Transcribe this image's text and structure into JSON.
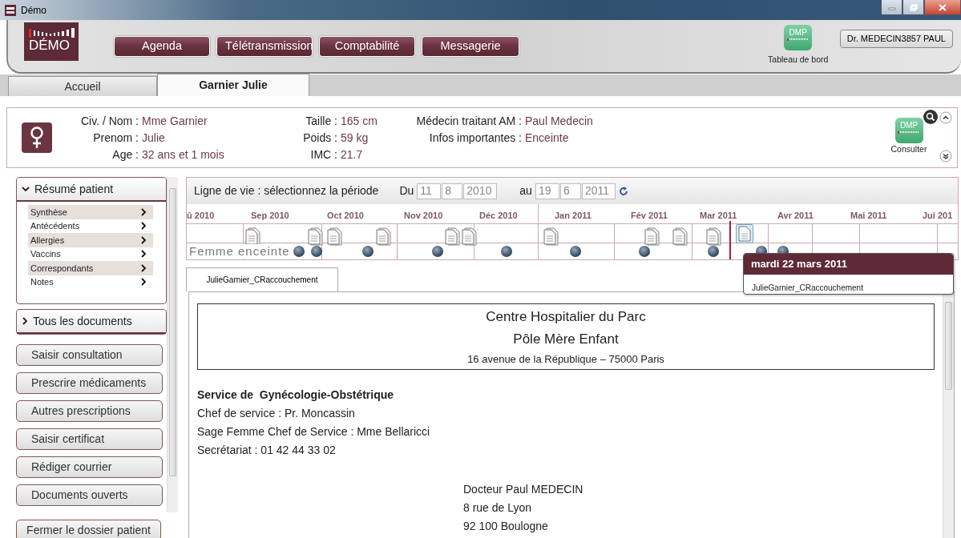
{
  "window": {
    "title": "Démo"
  },
  "logo": {
    "text": "DÉMO"
  },
  "nav_buttons": [
    "Agenda",
    "Télétransmission",
    "Comptabilité",
    "Messagerie"
  ],
  "dashboard": {
    "badge": "DMP",
    "label": "Tableau de bord"
  },
  "user": "Dr. MEDECIN3857 PAUL",
  "tabs": [
    {
      "label": "Accueil",
      "selected": false
    },
    {
      "label": "Garnier Julie",
      "selected": true
    }
  ],
  "patient": {
    "groups": [
      [
        {
          "label": "Civ. / Nom :",
          "value": "Mme Garnier"
        },
        {
          "label": "Prenom :",
          "value": "Julie"
        },
        {
          "label": "Age :",
          "value": "32 ans et 1 mois"
        }
      ],
      [
        {
          "label": "Taille :",
          "value": "165 cm"
        },
        {
          "label": "Poids :",
          "value": "59 kg"
        },
        {
          "label": "IMC :",
          "value": "21.7"
        }
      ],
      [
        {
          "label": "Médecin traitant AM :",
          "value": "Paul Medecin"
        },
        {
          "label": "Infos importantes :",
          "value": "Enceinte"
        }
      ]
    ],
    "dmp": {
      "badge": "DMP",
      "label": "Consulter"
    }
  },
  "sidebar": {
    "sections": [
      {
        "title": "Résumé patient",
        "expanded": true,
        "items": [
          "Synthèse",
          "Antécédents",
          "Allergies",
          "Vaccins",
          "Correspondants",
          "Notes"
        ]
      },
      {
        "title": "Tous les documents",
        "expanded": false
      }
    ],
    "buttons": [
      "Saisir consultation",
      "Prescrire médicaments",
      "Autres prescriptions",
      "Saisir certificat",
      "Rédiger courrier",
      "Documents ouverts"
    ],
    "close_button": "Fermer le dossier patient"
  },
  "timeline": {
    "title": "Ligne de vie : sélectionnez la période",
    "from_label": "Du",
    "from": [
      "11",
      "8",
      "2010"
    ],
    "to_label": "au",
    "to": [
      "19",
      "6",
      "2011"
    ],
    "months": [
      "û 2010",
      "Sep 2010",
      "Oct 2010",
      "Nov 2010",
      "Déc 2010",
      "Jan 2011",
      "Fév 2011",
      "Mar 2011",
      "Avr 2011",
      "Mai 2011",
      "Jui 201"
    ],
    "track_label": "Femme enceinte",
    "tooltip": {
      "date": "mardi 22 mars 2011",
      "item": "JulieGarnier_CRaccouchement"
    }
  },
  "document_tabs": [
    {
      "label": "JulieGarnier_CRaccouchement",
      "selected": true
    }
  ],
  "document": {
    "header": [
      "Centre Hospitalier du Parc",
      "Pôle Mère Enfant",
      "16 avenue de la République – 75000 Paris"
    ],
    "service_title": "Service de  Gynécologie-Obstétrique",
    "service_lines": [
      "Chef de service : Pr. Moncassin",
      "Sage Femme Chef de Service : Mme Bellaricci",
      "Secrétariat : 01 42 44 33 02"
    ],
    "recipient": [
      "Docteur Paul MEDECIN",
      "8 rue de Lyon",
      "92 100 Boulogne"
    ]
  }
}
